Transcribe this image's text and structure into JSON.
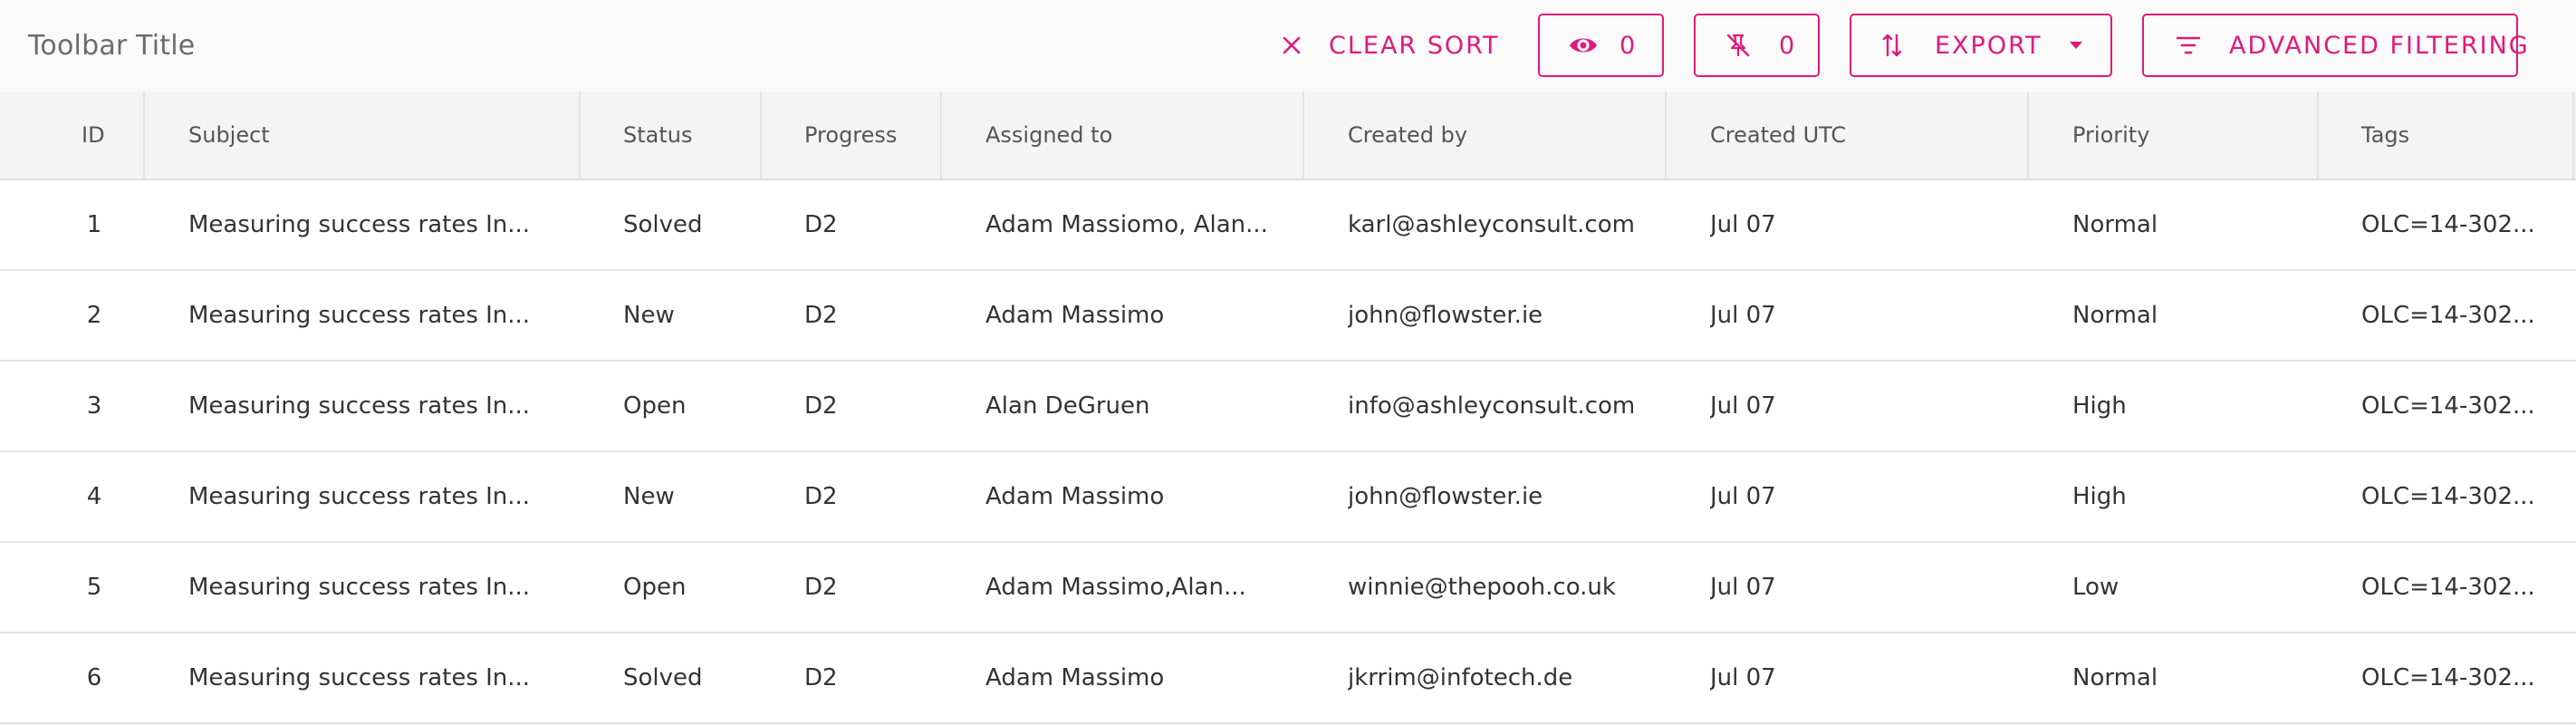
{
  "toolbar": {
    "title": "Toolbar Title",
    "clear_sort_label": "CLEAR SORT",
    "visible_count": "0",
    "pinned_count": "0",
    "export_label": "EXPORT",
    "advanced_filtering_label": "ADVANCED FILTERING"
  },
  "colors": {
    "accent": "#e0197d",
    "toolbar_bg": "#fafafa",
    "header_bg": "#f4f4f4",
    "row_border": "#e2e2e2"
  },
  "icons": {
    "clear_sort": "close-icon",
    "visible": "eye-icon",
    "pinned": "unpin-icon",
    "export": "sort-arrows-icon",
    "export_dropdown": "caret-down-icon",
    "advanced_filtering": "filter-lines-icon"
  },
  "table": {
    "columns": [
      "ID",
      "Subject",
      "Status",
      "Progress",
      "Assigned to",
      "Created by",
      "Created UTC",
      "Priority",
      "Tags"
    ],
    "rows": [
      [
        "1",
        "Measuring success rates In...",
        "Solved",
        "D2",
        "Adam Massiomo, Alan...",
        "karl@ashleyconsult.com",
        "Jul 07",
        "Normal",
        "OLC=14-302..."
      ],
      [
        "2",
        "Measuring success rates In...",
        "New",
        "D2",
        "Adam Massimo",
        "john@flowster.ie",
        "Jul 07",
        "Normal",
        "OLC=14-302..."
      ],
      [
        "3",
        "Measuring success rates In...",
        "Open",
        "D2",
        "Alan DeGruen",
        "info@ashleyconsult.com",
        "Jul 07",
        "High",
        "OLC=14-302..."
      ],
      [
        "4",
        "Measuring success rates In...",
        "New",
        "D2",
        "Adam Massimo",
        "john@flowster.ie",
        "Jul 07",
        "High",
        "OLC=14-302..."
      ],
      [
        "5",
        "Measuring success rates In...",
        "Open",
        "D2",
        "Adam Massimo,Alan...",
        "winnie@thepooh.co.uk",
        "Jul 07",
        "Low",
        "OLC=14-302..."
      ],
      [
        "6",
        "Measuring success rates In...",
        "Solved",
        "D2",
        "Adam Massimo",
        "jkrrim@infotech.de",
        "Jul 07",
        "Normal",
        "OLC=14-302..."
      ]
    ]
  }
}
